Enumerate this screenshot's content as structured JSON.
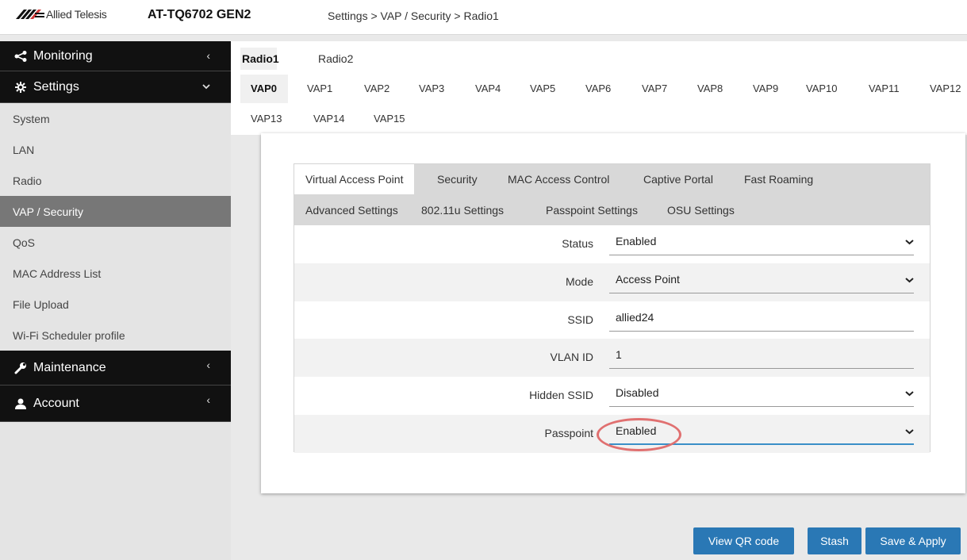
{
  "header": {
    "brand": "Allied Telesis",
    "model": "AT-TQ6702 GEN2",
    "breadcrumb": "Settings > VAP / Security > Radio1"
  },
  "sidebar": {
    "sections": [
      {
        "label": "Monitoring",
        "icon": "share-icon",
        "chevron": "‹"
      },
      {
        "label": "Settings",
        "icon": "gear-icon",
        "chevron": "⌄"
      }
    ],
    "items": [
      {
        "label": "System"
      },
      {
        "label": "LAN"
      },
      {
        "label": "Radio"
      },
      {
        "label": "VAP / Security"
      },
      {
        "label": "QoS"
      },
      {
        "label": "MAC Address List"
      },
      {
        "label": "File Upload"
      },
      {
        "label": "Wi-Fi Scheduler profile"
      }
    ],
    "bottom_sections": [
      {
        "label": "Maintenance",
        "icon": "wrench-icon",
        "chevron": "‹"
      },
      {
        "label": "Account",
        "icon": "user-icon",
        "chevron": "‹"
      }
    ],
    "active_item": "VAP / Security"
  },
  "radio_tabs": [
    "Radio1",
    "Radio2"
  ],
  "vap_tabs": [
    "VAP0",
    "VAP1",
    "VAP2",
    "VAP3",
    "VAP4",
    "VAP5",
    "VAP6",
    "VAP7",
    "VAP8",
    "VAP9",
    "VAP10",
    "VAP11",
    "VAP12",
    "VAP13",
    "VAP14",
    "VAP15"
  ],
  "sub_tabs": {
    "row1": [
      "Virtual Access Point",
      "Security",
      "MAC Access Control",
      "Captive Portal",
      "Fast Roaming"
    ],
    "row2": [
      "Advanced Settings",
      "802.11u Settings",
      "Passpoint Settings",
      "OSU Settings"
    ]
  },
  "form": {
    "status": {
      "label": "Status",
      "value": "Enabled"
    },
    "mode": {
      "label": "Mode",
      "value": "Access Point"
    },
    "ssid": {
      "label": "SSID",
      "value": "allied24"
    },
    "vlan": {
      "label": "VLAN ID",
      "value": "1"
    },
    "hidden_ssid": {
      "label": "Hidden SSID",
      "value": "Disabled"
    },
    "passpoint": {
      "label": "Passpoint",
      "value": "Enabled"
    }
  },
  "buttons": {
    "view_qr": "View QR code",
    "stash": "Stash",
    "save_apply": "Save & Apply"
  },
  "colors": {
    "accent": "#2a78b5",
    "highlight": "#e07070",
    "sidebar_dark": "#111111",
    "sidebar_active": "#777777"
  }
}
